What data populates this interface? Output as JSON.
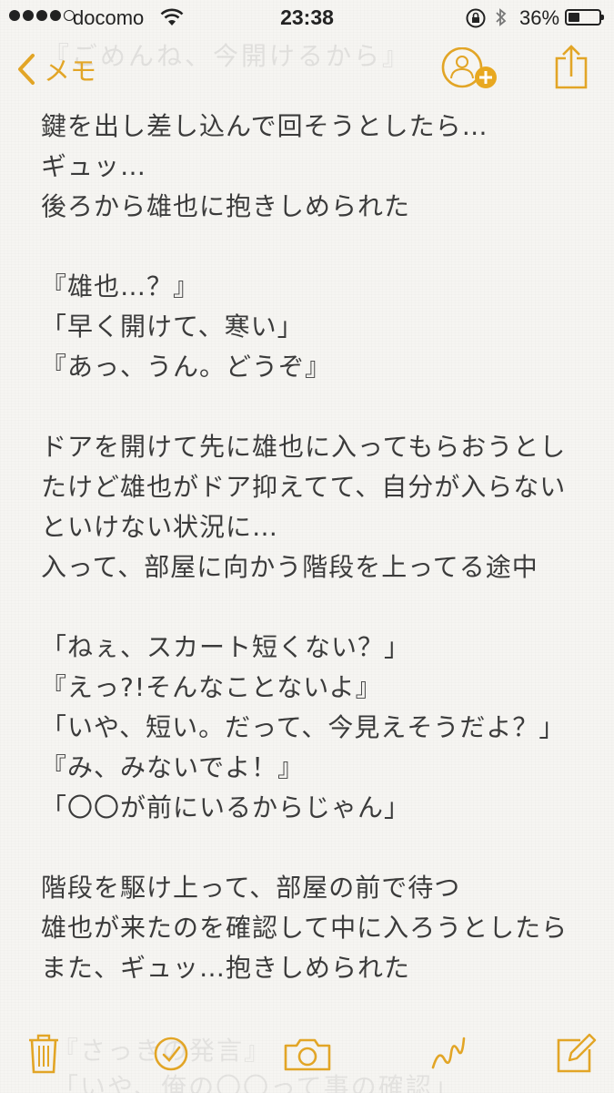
{
  "status_bar": {
    "carrier": "docomo",
    "time": "23:38",
    "battery_percent": "36%",
    "battery_level": 0.36,
    "signal_bars": 4,
    "signal_total": 5
  },
  "nav": {
    "back_label": "メモ",
    "ghost_text": "『ごめんね、今開けるから』"
  },
  "note": {
    "lines": [
      "鍵を出し差し込んで回そうとしたら…",
      "ギュッ…",
      "後ろから雄也に抱きしめられた",
      "",
      "『雄也…？』",
      "「早く開けて、寒い」",
      "『あっ、うん。どうぞ』",
      "",
      "ドアを開けて先に雄也に入ってもらおうとし",
      "たけど雄也がドア抑えてて、自分が入らない",
      "といけない状況に…",
      "入って、部屋に向かう階段を上ってる途中",
      "",
      "「ねぇ、スカート短くない？」",
      "『えっ?!そんなことないよ』",
      "「いや、短い。だって、今見えそうだよ？」",
      "『み、みないでよ！』",
      "「〇〇が前にいるからじゃん」",
      "",
      "階段を駆け上って、部屋の前で待つ",
      "雄也が来たのを確認して中に入ろうとしたら",
      "また、ギュッ…抱きしめられた"
    ],
    "ghost_bottom_1": "『さっきの発言』",
    "ghost_bottom_2": "「いや、俺の〇〇って事の確認」"
  },
  "colors": {
    "accent": "#e2a526",
    "text": "#3b3b3b",
    "background": "#f6f5f2"
  },
  "toolbar": {
    "icons": [
      "trash-icon",
      "checklist-icon",
      "camera-icon",
      "sketch-icon",
      "compose-icon"
    ]
  }
}
